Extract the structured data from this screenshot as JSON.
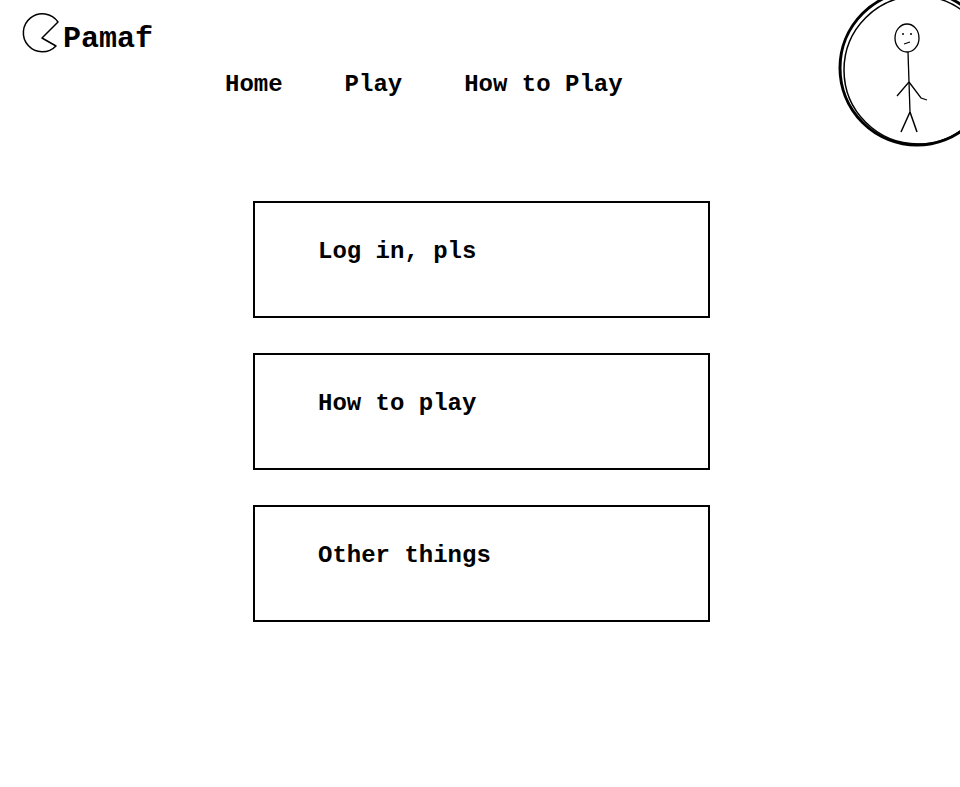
{
  "logo": {
    "text": "Pamaf"
  },
  "nav": [
    {
      "label": "Home"
    },
    {
      "label": "Play"
    },
    {
      "label": "How to Play"
    }
  ],
  "cards": [
    {
      "label": "Log in, pls"
    },
    {
      "label": "How to play"
    },
    {
      "label": "Other things"
    }
  ]
}
